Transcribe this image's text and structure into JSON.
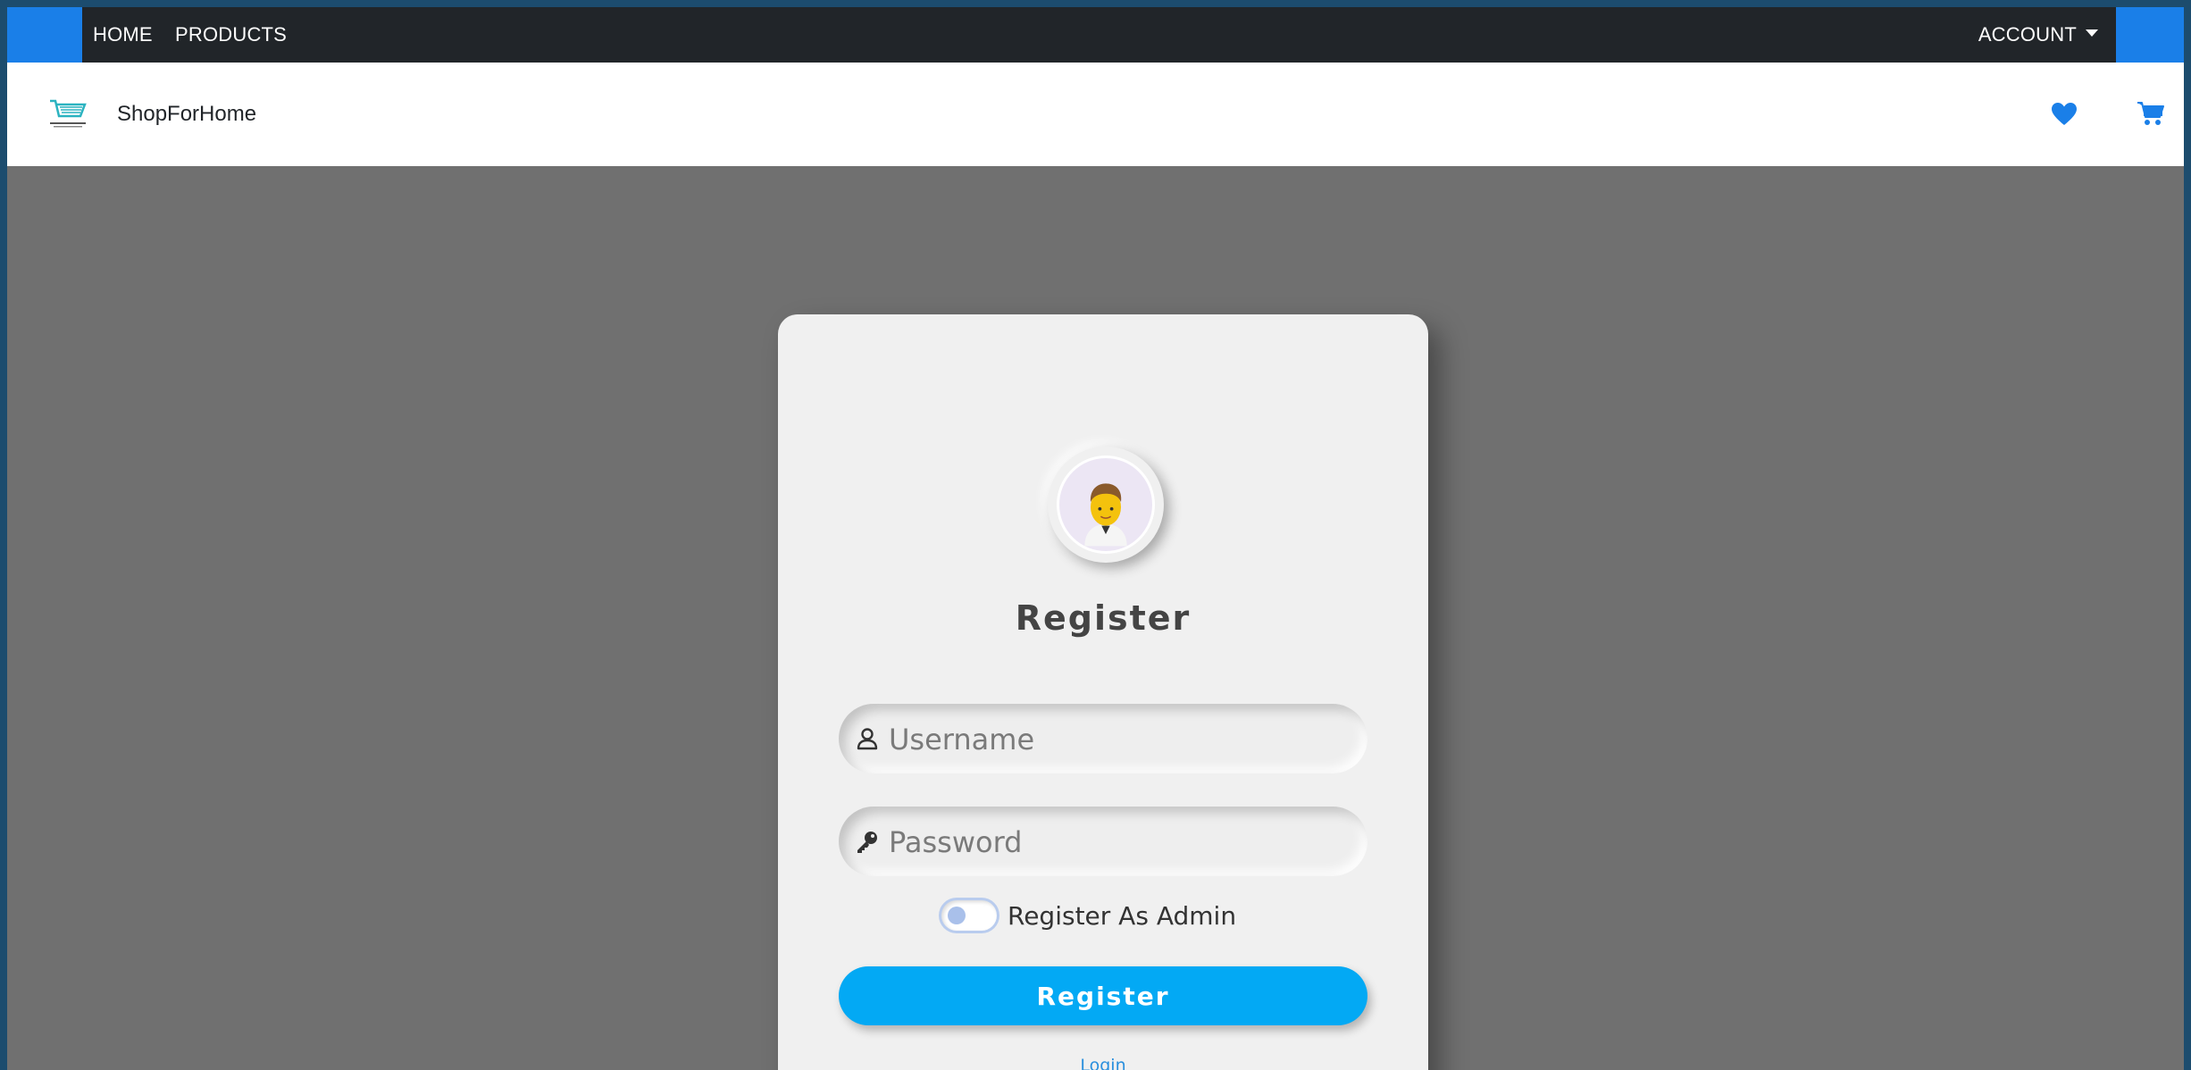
{
  "topnav": {
    "home_label": "HOME",
    "products_label": "PRODUCTS",
    "account_label": "ACCOUNT",
    "accent_color": "#1a7fe8",
    "background_color": "#212529"
  },
  "brandbar": {
    "logo_icon": "shopping-cart-logo-icon",
    "brand_name": "ShopForHome",
    "wishlist_icon": "heart-icon",
    "cart_icon": "cart-icon",
    "icon_color": "#1a7fe8"
  },
  "register_form": {
    "avatar_icon": "user-avatar-icon",
    "title": "Register",
    "username": {
      "icon": "user-icon",
      "placeholder": "Username",
      "value": ""
    },
    "password": {
      "icon": "key-icon",
      "placeholder": "Password",
      "value": ""
    },
    "admin_toggle": {
      "label": "Register As Admin",
      "checked": false
    },
    "submit_label": "Register",
    "submit_color": "#03a9f4",
    "login_link_label": "Login"
  }
}
